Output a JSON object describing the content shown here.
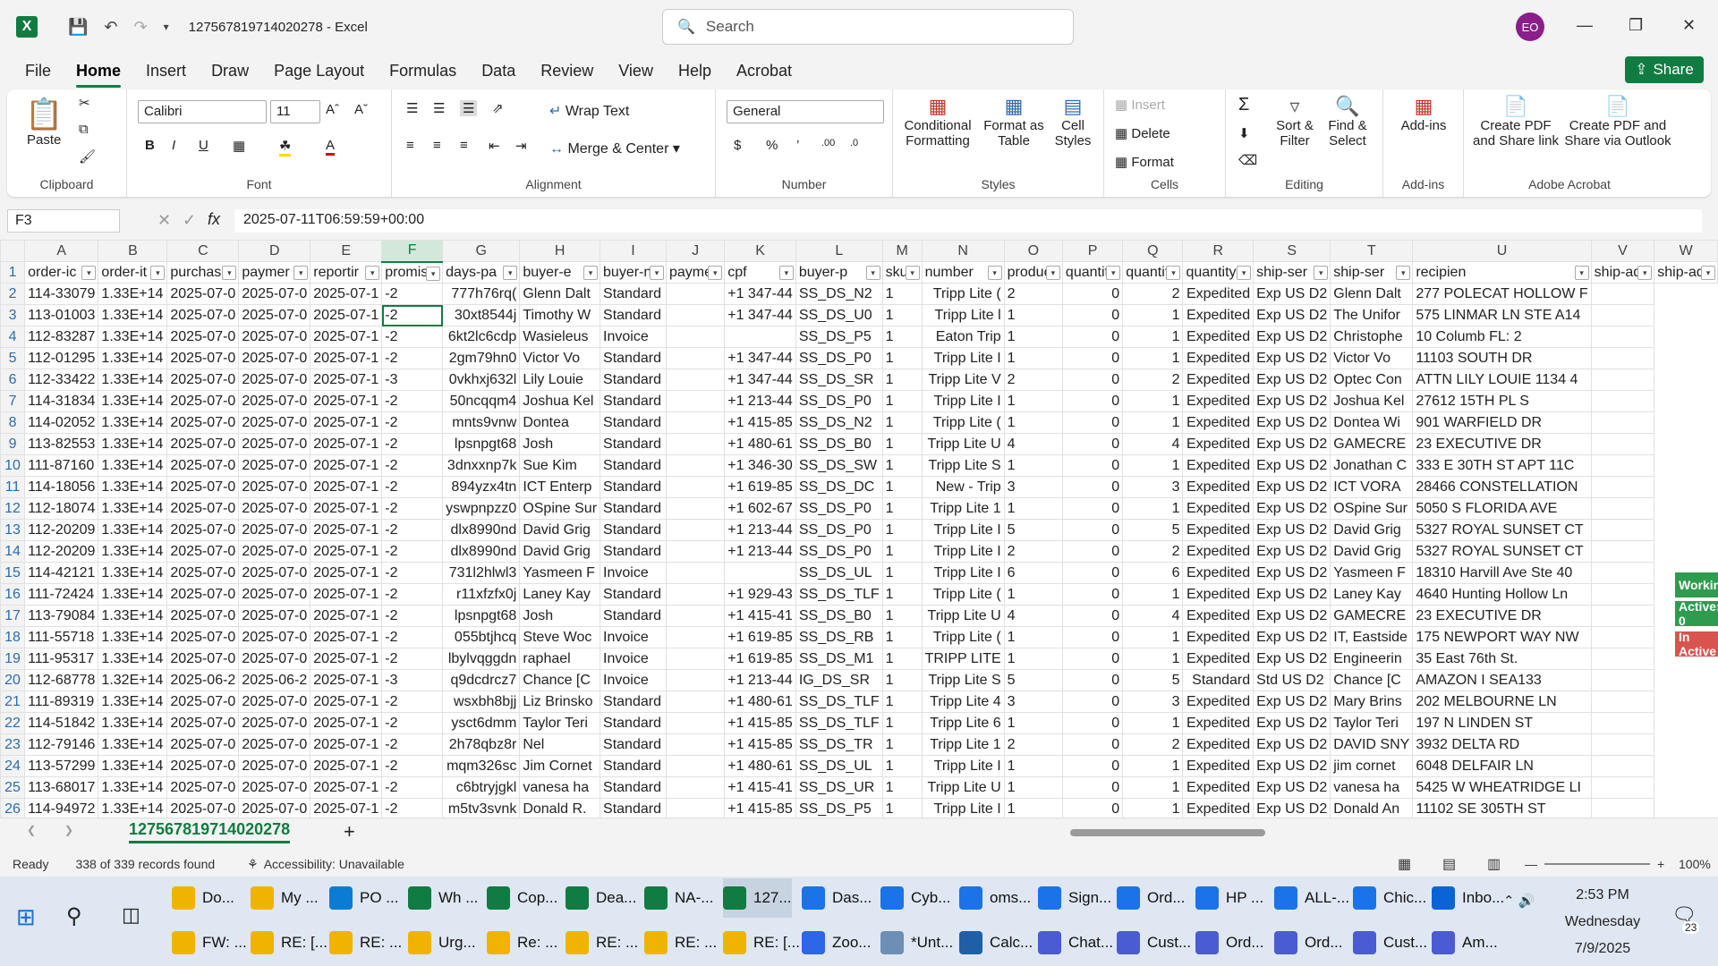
{
  "window": {
    "filename": "127567819714020278",
    "app": "Excel",
    "title": "127567819714020278  -  Excel",
    "user_initials": "EO"
  },
  "search": {
    "placeholder": "Search"
  },
  "menu": [
    "File",
    "Home",
    "Insert",
    "Draw",
    "Page Layout",
    "Formulas",
    "Data",
    "Review",
    "View",
    "Help",
    "Acrobat"
  ],
  "share_label": "Share",
  "ribbon": {
    "clipboard": {
      "label": "Clipboard",
      "paste": "Paste"
    },
    "font": {
      "label": "Font",
      "family": "Calibri",
      "size": "11"
    },
    "alignment": {
      "label": "Alignment",
      "wrap": "Wrap Text",
      "merge": "Merge & Center"
    },
    "number": {
      "label": "Number",
      "format": "General"
    },
    "styles": {
      "label": "Styles",
      "conditional": "Conditional Formatting",
      "format_table": "Format as Table",
      "cell_styles": "Cell Styles"
    },
    "cells": {
      "label": "Cells",
      "insert": "Insert",
      "delete": "Delete",
      "format": "Format"
    },
    "editing": {
      "label": "Editing",
      "sort": "Sort & Filter",
      "find": "Find & Select"
    },
    "addins": {
      "label": "Add-ins",
      "addins": "Add-ins"
    },
    "acrobat": {
      "label": "Adobe Acrobat",
      "pdf_link": "Create PDF and Share link",
      "pdf_outlook": "Create PDF and Share via Outlook"
    }
  },
  "namebox": "F3",
  "formula": "2025-07-11T06:59:59+00:00",
  "columns": [
    "A",
    "B",
    "C",
    "D",
    "E",
    "F",
    "G",
    "H",
    "I",
    "J",
    "K",
    "L",
    "M",
    "N",
    "O",
    "P",
    "Q",
    "R",
    "S",
    "T",
    "U",
    "V",
    "W"
  ],
  "selected_column": "F",
  "header_row": [
    "order-ic",
    "order-it",
    "purchas",
    "paymer",
    "reportir",
    "promise",
    "days-pa",
    "buyer-e",
    "buyer-n",
    "paymer",
    "cpf",
    "buyer-p",
    "sku",
    "number",
    "product",
    "quantity",
    "quantity",
    "quantity",
    "ship-ser",
    "ship-ser",
    "recipien",
    "ship-adc",
    "ship-adc"
  ],
  "rows": [
    [
      "2",
      "114-33079",
      "1.33E+14",
      "2025-07-0",
      "2025-07-0",
      "2025-07-1",
      "-2",
      "777h76rq(",
      "Glenn Dalt",
      "Standard",
      "",
      "+1 347-44",
      "SS_DS_N2",
      "1",
      "Tripp Lite (",
      "2",
      "0",
      "2",
      "Expedited",
      "Exp US D2",
      "Glenn Dalt",
      "277 POLECAT HOLLOW F",
      ""
    ],
    [
      "3",
      "113-01003",
      "1.33E+14",
      "2025-07-0",
      "2025-07-0",
      "2025-07-1",
      "-2",
      "30xt8544j",
      "Timothy W",
      "Standard",
      "",
      "+1 347-44",
      "SS_DS_U0",
      "1",
      "Tripp Lite l",
      "1",
      "0",
      "1",
      "Expedited",
      "Exp US D2",
      "The Unifor",
      "575 LINMAR LN STE A14",
      ""
    ],
    [
      "4",
      "112-83287",
      "1.33E+14",
      "2025-07-0",
      "2025-07-0",
      "2025-07-1",
      "-2",
      "6kt2lc6cdp",
      "Wasieleus",
      "Invoice",
      "",
      "",
      "SS_DS_P5",
      "1",
      "Eaton Trip",
      "1",
      "0",
      "1",
      "Expedited",
      "Exp US D2",
      "Christophe",
      "10 Columb FL: 2",
      ""
    ],
    [
      "5",
      "112-01295",
      "1.33E+14",
      "2025-07-0",
      "2025-07-0",
      "2025-07-1",
      "-2",
      "2gm79hn0",
      "Victor Vo",
      "Standard",
      "",
      "+1 347-44",
      "SS_DS_P0",
      "1",
      "Tripp Lite I",
      "1",
      "0",
      "1",
      "Expedited",
      "Exp US D2",
      "Victor Vo",
      "11103 SOUTH DR",
      ""
    ],
    [
      "6",
      "112-33422",
      "1.33E+14",
      "2025-07-0",
      "2025-07-0",
      "2025-07-1",
      "-3",
      "0vkhxj632l",
      "Lily Louie",
      "Standard",
      "",
      "+1 347-44",
      "SS_DS_SR",
      "1",
      "Tripp Lite V",
      "2",
      "0",
      "2",
      "Expedited",
      "Exp US D2",
      "Optec Con",
      "ATTN LILY LOUIE 1134 4",
      ""
    ],
    [
      "7",
      "114-31834",
      "1.33E+14",
      "2025-07-0",
      "2025-07-0",
      "2025-07-1",
      "-2",
      "50ncqqm4",
      "Joshua Kel",
      "Standard",
      "",
      "+1 213-44",
      "SS_DS_P0",
      "1",
      "Tripp Lite I",
      "1",
      "0",
      "1",
      "Expedited",
      "Exp US D2",
      "Joshua Kel",
      "27612 15TH PL S",
      ""
    ],
    [
      "8",
      "114-02052",
      "1.33E+14",
      "2025-07-0",
      "2025-07-0",
      "2025-07-1",
      "-2",
      "mnts9vnw",
      "Dontea",
      "Standard",
      "",
      "+1 415-85",
      "SS_DS_N2",
      "1",
      "Tripp Lite (",
      "1",
      "0",
      "1",
      "Expedited",
      "Exp US D2",
      "Dontea Wi",
      "901 WARFIELD DR",
      ""
    ],
    [
      "9",
      "113-82553",
      "1.33E+14",
      "2025-07-0",
      "2025-07-0",
      "2025-07-1",
      "-2",
      "lpsnpgt68",
      "Josh",
      "Standard",
      "",
      "+1 480-61",
      "SS_DS_B0",
      "1",
      "Tripp Lite U",
      "4",
      "0",
      "4",
      "Expedited",
      "Exp US D2",
      "GAMECRE",
      "23 EXECUTIVE DR",
      ""
    ],
    [
      "10",
      "111-87160",
      "1.33E+14",
      "2025-07-0",
      "2025-07-0",
      "2025-07-1",
      "-2",
      "3dnxxnp7k",
      "Sue Kim",
      "Standard",
      "",
      "+1 346-30",
      "SS_DS_SW",
      "1",
      "Tripp Lite S",
      "1",
      "0",
      "1",
      "Expedited",
      "Exp US D2",
      "Jonathan C",
      "333 E 30TH ST APT 11C",
      ""
    ],
    [
      "11",
      "114-18056",
      "1.33E+14",
      "2025-07-0",
      "2025-07-0",
      "2025-07-1",
      "-2",
      "894yzx4tn",
      "ICT Enterp",
      "Standard",
      "",
      "+1 619-85",
      "SS_DS_DC",
      "1",
      "New - Trip",
      "3",
      "0",
      "3",
      "Expedited",
      "Exp US D2",
      "ICT VORA",
      "28466 CONSTELLATION",
      ""
    ],
    [
      "12",
      "112-18074",
      "1.33E+14",
      "2025-07-0",
      "2025-07-0",
      "2025-07-1",
      "-2",
      "yswpnpzz0",
      "OSpine Sur",
      "Standard",
      "",
      "+1 602-67",
      "SS_DS_P0",
      "1",
      "Tripp Lite 1",
      "1",
      "0",
      "1",
      "Expedited",
      "Exp US D2",
      "OSpine Sur",
      "5050 S FLORIDA AVE",
      ""
    ],
    [
      "13",
      "112-20209",
      "1.33E+14",
      "2025-07-0",
      "2025-07-0",
      "2025-07-1",
      "-2",
      "dlx8990nd",
      "David Grig",
      "Standard",
      "",
      "+1 213-44",
      "SS_DS_P0",
      "1",
      "Tripp Lite I",
      "5",
      "0",
      "5",
      "Expedited",
      "Exp US D2",
      "David Grig",
      "5327 ROYAL SUNSET CT",
      ""
    ],
    [
      "14",
      "112-20209",
      "1.33E+14",
      "2025-07-0",
      "2025-07-0",
      "2025-07-1",
      "-2",
      "dlx8990nd",
      "David Grig",
      "Standard",
      "",
      "+1 213-44",
      "SS_DS_P0",
      "1",
      "Tripp Lite I",
      "2",
      "0",
      "2",
      "Expedited",
      "Exp US D2",
      "David Grig",
      "5327 ROYAL SUNSET CT",
      ""
    ],
    [
      "15",
      "114-42121",
      "1.33E+14",
      "2025-07-0",
      "2025-07-0",
      "2025-07-1",
      "-2",
      "731l2hlwl3",
      "Yasmeen F",
      "Invoice",
      "",
      "",
      "SS_DS_UL",
      "1",
      "Tripp Lite I",
      "6",
      "0",
      "6",
      "Expedited",
      "Exp US D2",
      "Yasmeen F",
      "18310 Harvill Ave Ste 40",
      ""
    ],
    [
      "16",
      "111-72424",
      "1.33E+14",
      "2025-07-0",
      "2025-07-0",
      "2025-07-1",
      "-2",
      "r11xfzfx0j",
      "Laney Kay",
      "Standard",
      "",
      "+1 929-43",
      "SS_DS_TLF",
      "1",
      "Tripp Lite (",
      "1",
      "0",
      "1",
      "Expedited",
      "Exp US D2",
      "Laney Kay",
      "4640 Hunting Hollow Ln",
      ""
    ],
    [
      "17",
      "113-79084",
      "1.33E+14",
      "2025-07-0",
      "2025-07-0",
      "2025-07-1",
      "-2",
      "lpsnpgt68",
      "Josh",
      "Standard",
      "",
      "+1 415-41",
      "SS_DS_B0",
      "1",
      "Tripp Lite U",
      "4",
      "0",
      "4",
      "Expedited",
      "Exp US D2",
      "GAMECRE",
      "23 EXECUTIVE DR",
      ""
    ],
    [
      "18",
      "111-55718",
      "1.33E+14",
      "2025-07-0",
      "2025-07-0",
      "2025-07-1",
      "-2",
      "055btjhcq",
      "Steve Woc",
      "Invoice",
      "",
      "+1 619-85",
      "SS_DS_RB",
      "1",
      "Tripp Lite (",
      "1",
      "0",
      "1",
      "Expedited",
      "Exp US D2",
      "IT, Eastside",
      "175 NEWPORT WAY NW",
      ""
    ],
    [
      "19",
      "111-95317",
      "1.33E+14",
      "2025-07-0",
      "2025-07-0",
      "2025-07-1",
      "-2",
      "lbylvqggdn",
      "raphael",
      "Invoice",
      "",
      "+1 619-85",
      "SS_DS_M1",
      "1",
      "TRIPP LITE",
      "1",
      "0",
      "1",
      "Expedited",
      "Exp US D2",
      "Engineerin",
      "35 East 76th St.",
      ""
    ],
    [
      "20",
      "112-68778",
      "1.32E+14",
      "2025-06-2",
      "2025-06-2",
      "2025-07-1",
      "-3",
      "q9dcdrcz7",
      "Chance [C",
      "Invoice",
      "",
      "+1 213-44",
      "IG_DS_SR",
      "1",
      "Tripp Lite S",
      "5",
      "0",
      "5",
      "Standard",
      "Std US D2",
      "Chance [C",
      "AMAZON I SEA133",
      ""
    ],
    [
      "21",
      "111-89319",
      "1.33E+14",
      "2025-07-0",
      "2025-07-0",
      "2025-07-1",
      "-2",
      "wsxbh8bjj",
      "Liz Brinsko",
      "Standard",
      "",
      "+1 480-61",
      "SS_DS_TLF",
      "1",
      "Tripp Lite 4",
      "3",
      "0",
      "3",
      "Expedited",
      "Exp US D2",
      "Mary Brins",
      "202 MELBOURNE LN",
      ""
    ],
    [
      "22",
      "114-51842",
      "1.33E+14",
      "2025-07-0",
      "2025-07-0",
      "2025-07-1",
      "-2",
      "ysct6dmm",
      "Taylor Teri",
      "Standard",
      "",
      "+1 415-85",
      "SS_DS_TLF",
      "1",
      "Tripp Lite 6",
      "1",
      "0",
      "1",
      "Expedited",
      "Exp US D2",
      "Taylor Teri",
      "197 N LINDEN ST",
      ""
    ],
    [
      "23",
      "112-79146",
      "1.33E+14",
      "2025-07-0",
      "2025-07-0",
      "2025-07-1",
      "-2",
      "2h78qbz8r",
      "Nel",
      "Standard",
      "",
      "+1 415-85",
      "SS_DS_TR",
      "1",
      "Tripp Lite 1",
      "2",
      "0",
      "2",
      "Expedited",
      "Exp US D2",
      "DAVID SNY",
      "3932 DELTA RD",
      ""
    ],
    [
      "24",
      "113-57299",
      "1.33E+14",
      "2025-07-0",
      "2025-07-0",
      "2025-07-1",
      "-2",
      "mqm326sc",
      "Jim Cornet",
      "Standard",
      "",
      "+1 480-61",
      "SS_DS_UL",
      "1",
      "Tripp Lite I",
      "1",
      "0",
      "1",
      "Expedited",
      "Exp US D2",
      "jim cornet",
      "6048 DELFAIR LN",
      ""
    ],
    [
      "25",
      "113-68017",
      "1.33E+14",
      "2025-07-0",
      "2025-07-0",
      "2025-07-1",
      "-2",
      "c6btryjgkl",
      "vanesa ha",
      "Standard",
      "",
      "+1 415-41",
      "SS_DS_UR",
      "1",
      "Tripp Lite U",
      "1",
      "0",
      "1",
      "Expedited",
      "Exp US D2",
      "vanesa ha",
      "5425 W WHEATRIDGE LI",
      ""
    ],
    [
      "26",
      "114-94972",
      "1.33E+14",
      "2025-07-0",
      "2025-07-0",
      "2025-07-1",
      "-2",
      "m5tv3svnk",
      "Donald R.",
      "Standard",
      "",
      "+1 415-85",
      "SS_DS_P5",
      "1",
      "Tripp Lite I",
      "1",
      "0",
      "1",
      "Expedited",
      "Exp US D2",
      "Donald An",
      "11102 SE 305TH ST",
      ""
    ]
  ],
  "sheet_tab": "127567819714020278",
  "status": {
    "ready": "Ready",
    "records": "338 of 339 records found",
    "accessibility": "Accessibility: Unavailable",
    "zoom": "100%"
  },
  "overlay": {
    "working": "Working",
    "active": "Active: 0",
    "inactive": "In Active"
  },
  "taskbar": {
    "row1": [
      "Do...",
      "My ...",
      "PO ...",
      "Wh ...",
      "Cop...",
      "Dea...",
      "NA-...",
      "127...",
      "Das...",
      "Cyb...",
      "oms...",
      "Sign...",
      "Ord...",
      "HP ...",
      "ALL-...",
      "Chic...",
      "Inbo..."
    ],
    "row2": [
      "FW: ...",
      "RE: [...",
      "RE: ...",
      "Urg...",
      "Re: ...",
      "RE: ...",
      "RE: ...",
      "RE: [...",
      "Zoo...",
      "*Unt...",
      "Calc...",
      "Chat...",
      "Cust...",
      "Ord...",
      "Ord...",
      "Cust...",
      "Am..."
    ],
    "time": "2:53 PM",
    "day": "Wednesday",
    "date": "7/9/2025",
    "notif": "23"
  },
  "colors": {
    "accent": "#107c41",
    "avatar": "#8a1f8a"
  }
}
